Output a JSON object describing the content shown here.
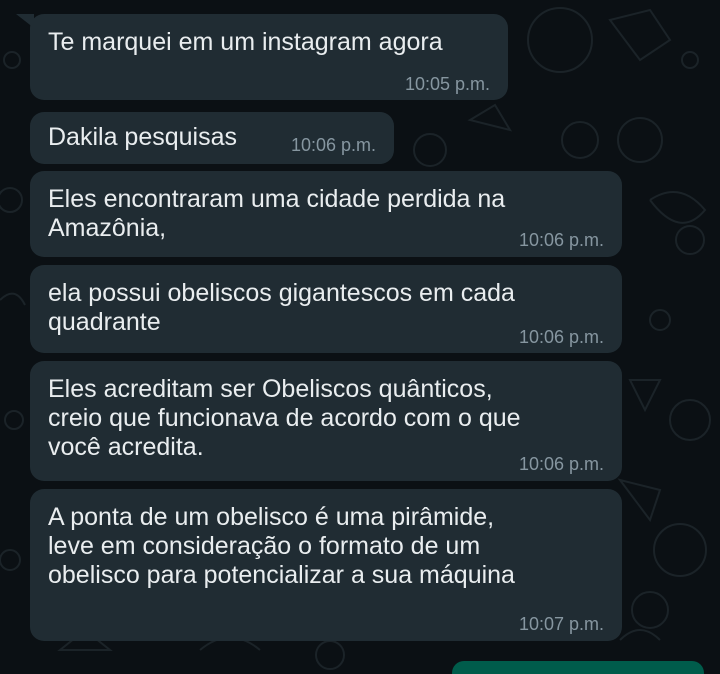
{
  "chat": {
    "messages": [
      {
        "text": "Te marquei em um instagram agora",
        "time": "10:05 p.m."
      },
      {
        "text": "Dakila pesquisas",
        "time": "10:06 p.m."
      },
      {
        "text": "Eles encontraram uma cidade perdida na\nAmazônia,",
        "time": "10:06 p.m."
      },
      {
        "text": "ela possui obeliscos gigantescos em cada\nquadrante",
        "time": "10:06 p.m."
      },
      {
        "text": "Eles acreditam ser Obeliscos quânticos,\ncreio que funcionava de acordo com o que\nvocê acredita.",
        "time": "10:06 p.m."
      },
      {
        "text": "A ponta de um obelisco é uma pirâmide,\nleve em consideração o formato de um\nobelisco para potencializar a sua máquina",
        "time": "10:07 p.m."
      }
    ]
  },
  "colors": {
    "background": "#0b1014",
    "incoming_bubble": "#202c33",
    "outgoing_bubble": "#005c4b",
    "message_text": "#e9edef",
    "timestamp_text": "#8696a0"
  }
}
